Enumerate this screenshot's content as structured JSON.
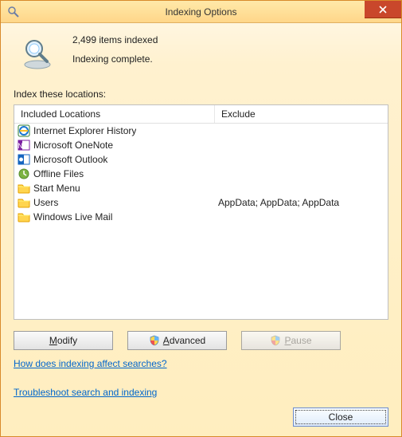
{
  "titlebar": {
    "title": "Indexing Options"
  },
  "status": {
    "count_line": "2,499 items indexed",
    "state_line": "Indexing complete."
  },
  "locations": {
    "label": "Index these locations:",
    "headers": {
      "included": "Included Locations",
      "exclude": "Exclude"
    },
    "rows": [
      {
        "icon": "ie",
        "label": "Internet Explorer History",
        "exclude": ""
      },
      {
        "icon": "onenote",
        "label": "Microsoft OneNote",
        "exclude": ""
      },
      {
        "icon": "outlook",
        "label": "Microsoft Outlook",
        "exclude": ""
      },
      {
        "icon": "offline",
        "label": "Offline Files",
        "exclude": ""
      },
      {
        "icon": "folder",
        "label": "Start Menu",
        "exclude": ""
      },
      {
        "icon": "folder",
        "label": "Users",
        "exclude": "AppData; AppData; AppData"
      },
      {
        "icon": "folder",
        "label": "Windows Live Mail",
        "exclude": ""
      }
    ]
  },
  "buttons": {
    "modify_pre": "",
    "modify_accel": "M",
    "modify_post": "odify",
    "advanced_accel": "A",
    "advanced_post": "dvanced",
    "pause_accel": "P",
    "pause_post": "ause",
    "close": "Close"
  },
  "links": {
    "help": "How does indexing affect searches?",
    "troubleshoot": "Troubleshoot search and indexing"
  }
}
